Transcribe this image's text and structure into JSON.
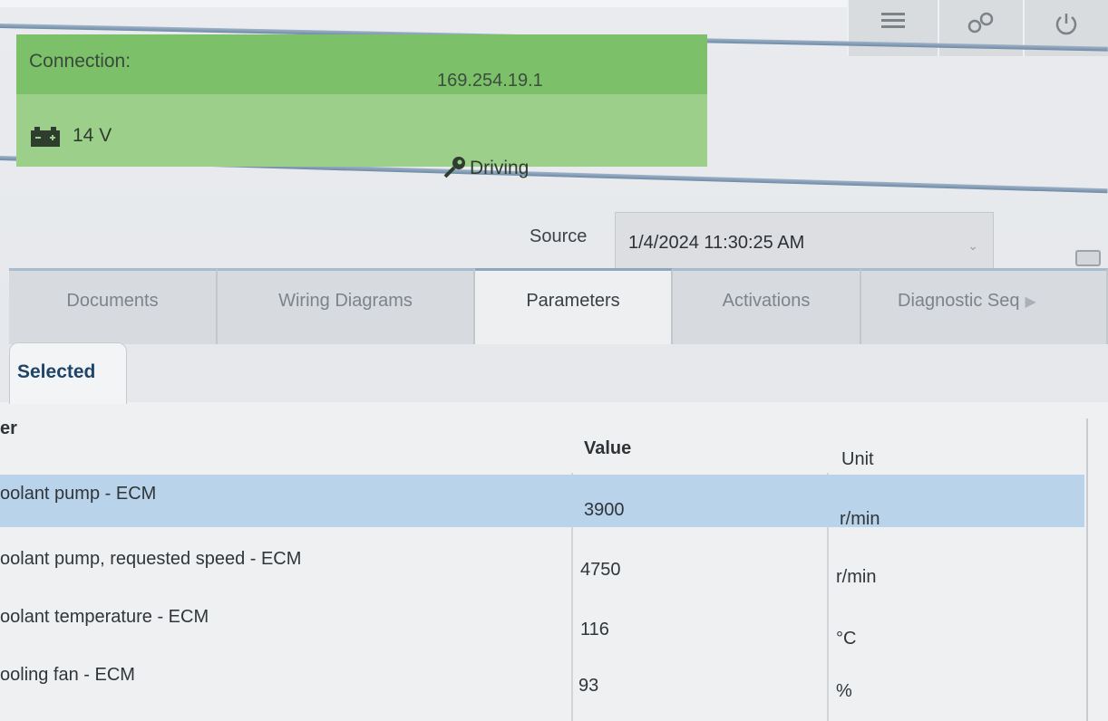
{
  "status": {
    "connection_label": "Connection:",
    "ip_address": "169.254.19.1",
    "voltage": "14 V",
    "mode": "Driving",
    "panel_color": "#7dc06a"
  },
  "source": {
    "label": "Source",
    "selected": "1/4/2024 11:30:25 AM"
  },
  "tabs": [
    {
      "label": "Documents"
    },
    {
      "label": "Wiring Diagrams"
    },
    {
      "label": "Parameters"
    },
    {
      "label": "Activations"
    },
    {
      "label": "Diagnostic Seq"
    }
  ],
  "subtab": {
    "label": "Selected"
  },
  "table": {
    "headers": {
      "name": "er",
      "value": "Value",
      "unit": "Unit"
    },
    "rows": [
      {
        "name": "oolant pump - ECM",
        "value": "3900",
        "unit": "r/min"
      },
      {
        "name": "oolant pump, requested speed - ECM",
        "value": "4750",
        "unit": "r/min"
      },
      {
        "name": "oolant temperature - ECM",
        "value": "116",
        "unit": "°C"
      },
      {
        "name": "ooling fan - ECM",
        "value": "93",
        "unit": "%"
      }
    ]
  }
}
